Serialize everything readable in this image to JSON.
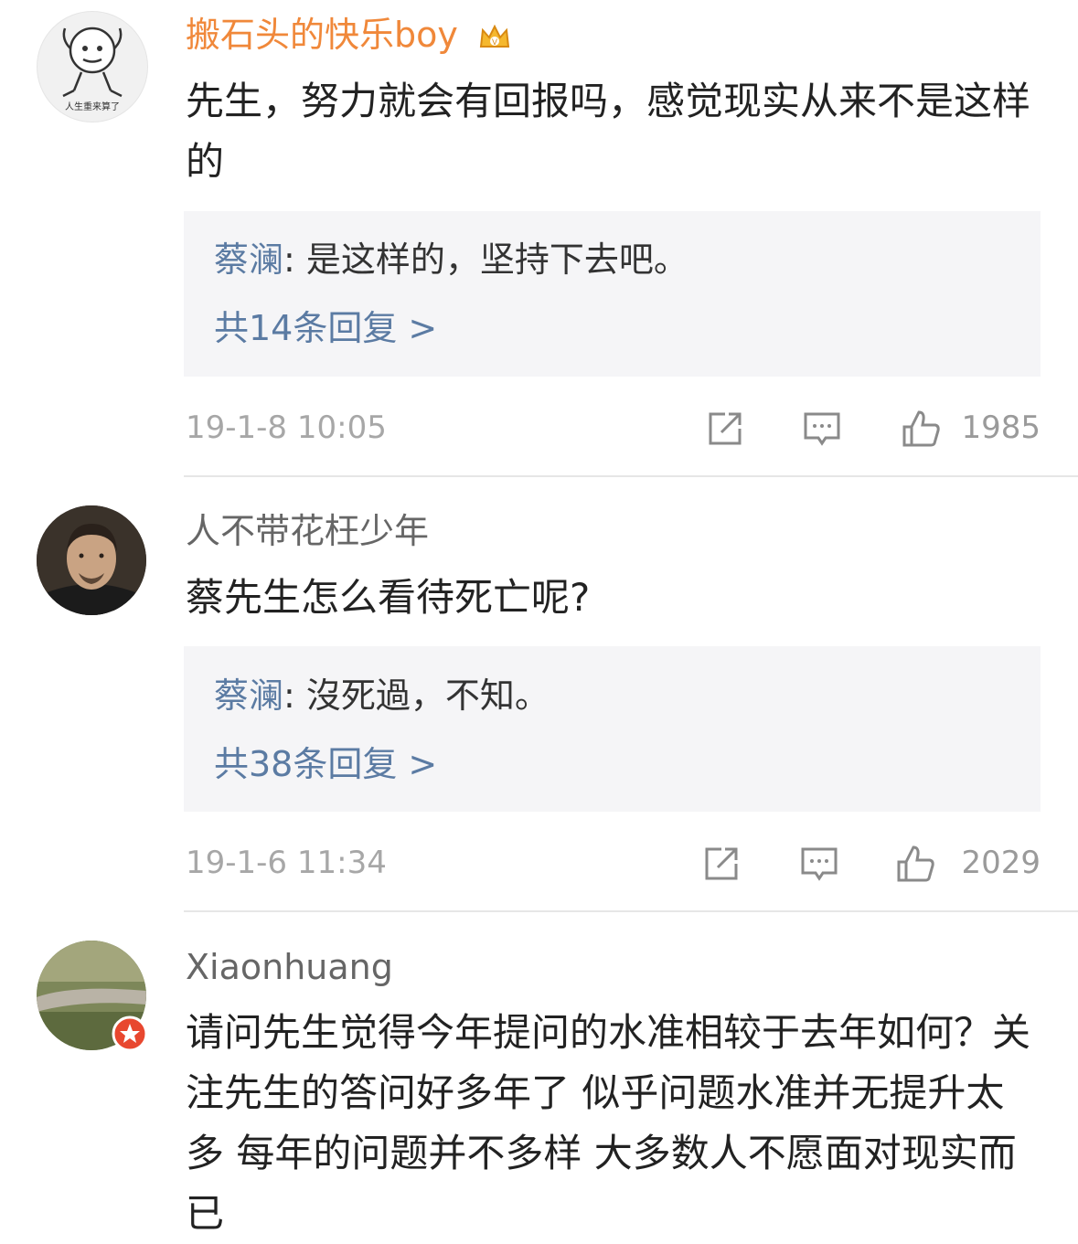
{
  "comments": [
    {
      "username": "搬石头的快乐boy",
      "avatar_caption": "人生重来算了",
      "text": "先生，努力就会有回报吗，感觉现实从来不是这样的",
      "reply_author": "蔡澜",
      "reply_text": ": 是这样的，坚持下去吧。",
      "reply_count": "共14条回复 >",
      "timestamp": "19-1-8 10:05",
      "likes": "1985"
    },
    {
      "username": "人不带花枉少年",
      "text": "蔡先生怎么看待死亡呢?",
      "reply_author": "蔡澜",
      "reply_text": ": 沒死過，不知。",
      "reply_count": "共38条回复 >",
      "timestamp": "19-1-6 11:34",
      "likes": "2029"
    },
    {
      "username": "Xiaonhuang",
      "text": "请问先生觉得今年提问的水准相较于去年如何？关注先生的答问好多年了 似乎问题水准并无提升太多 每年的问题并不多样 大多数人不愿面对现实而已"
    }
  ],
  "colors": {
    "vip_username": "#f0883a",
    "username": "#666666",
    "reply_link": "#5b7ba3",
    "reply_bg": "#f5f5f7",
    "meta_gray": "#a7a7a7",
    "badge": "#e8472f"
  },
  "icons": [
    "vip-crown-icon",
    "share-icon",
    "comment-icon",
    "like-icon",
    "verified-badge-icon"
  ]
}
